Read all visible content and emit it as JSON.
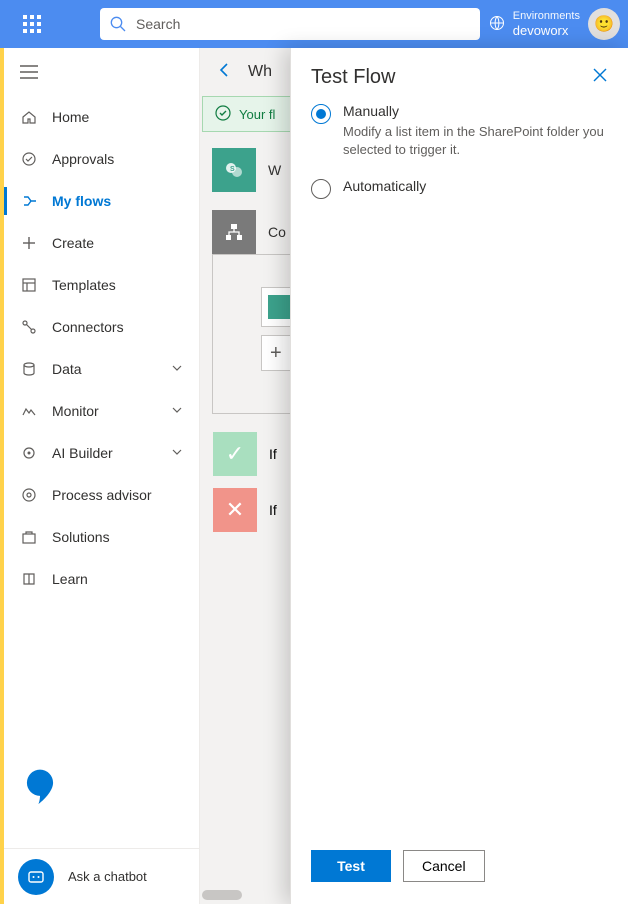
{
  "header": {
    "search_placeholder": "Search",
    "env_label": "Environments",
    "env_name": "devoworx"
  },
  "sidebar": {
    "items": [
      {
        "label": "Home"
      },
      {
        "label": "Approvals"
      },
      {
        "label": "My flows"
      },
      {
        "label": "Create"
      },
      {
        "label": "Templates"
      },
      {
        "label": "Connectors"
      },
      {
        "label": "Data"
      },
      {
        "label": "Monitor"
      },
      {
        "label": "AI Builder"
      },
      {
        "label": "Process advisor"
      },
      {
        "label": "Solutions"
      },
      {
        "label": "Learn"
      }
    ],
    "ask_bot": "Ask a chatbot"
  },
  "canvas": {
    "back_title": "Wh",
    "notice": "Your fl",
    "trigger_label": "W",
    "condition_label": "Co",
    "add_label": "+",
    "if_yes": "If",
    "if_no": "If"
  },
  "panel": {
    "title": "Test Flow",
    "options": [
      {
        "title": "Manually",
        "desc": "Modify a list item in the SharePoint folder you selected to trigger it."
      },
      {
        "title": "Automatically",
        "desc": ""
      }
    ],
    "test_btn": "Test",
    "cancel_btn": "Cancel"
  }
}
